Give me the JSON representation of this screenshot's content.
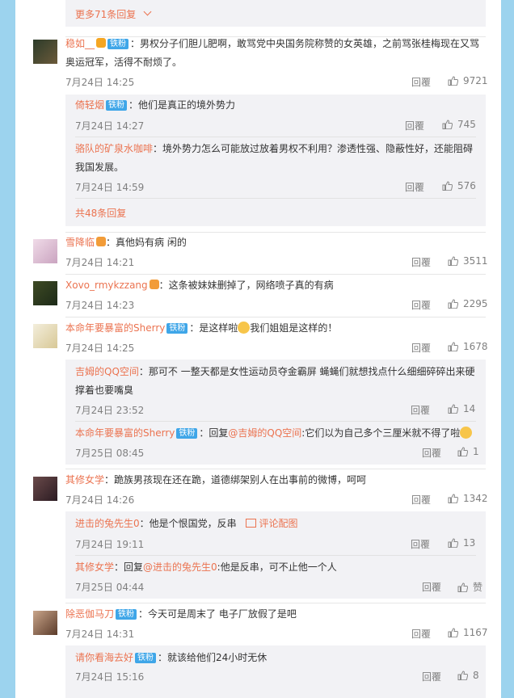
{
  "top_more": {
    "label": "更多71条回复"
  },
  "action_reply": "回覆",
  "comments": [
    {
      "user": "稳如__",
      "badge": "铁粉",
      "text": "：男权分子们胆儿肥啊，敢骂党中央国务院称赞的女英雄，之前骂张桂梅现在又骂奥运冠军，活得不耐烦了。",
      "time": "7月24日 14:25",
      "likes": "9721",
      "replies": [
        {
          "user": "倚轻烟",
          "badge": "铁粉",
          "text": "：他们是真正的境外势力",
          "time": "7月24日 14:27",
          "likes": "745"
        },
        {
          "user": "骆队的矿泉水咖啡",
          "text": "：境外势力怎么可能放过放着男权不利用？渗透性强、隐蔽性好，还能阻碍我国发展。",
          "time": "7月24日 14:59",
          "likes": "576"
        }
      ],
      "more": "共48条回复"
    },
    {
      "user": "雪降临",
      "text": "：真他妈有病 闲的",
      "time": "7月24日 14:21",
      "likes": "3511"
    },
    {
      "user": "Xovo_rmykzzang",
      "text": "：这条被妹妹删掉了，网络喷子真的有病",
      "time": "7月24日 14:23",
      "likes": "2295"
    },
    {
      "user": "本命年要暴富的Sherry",
      "badge": "铁粉",
      "text": "：是这样啦",
      "text2": "我们姐姐是这样的！",
      "time": "7月24日 14:25",
      "likes": "1678",
      "replies": [
        {
          "user": "吉姆的QQ空间",
          "text": "：那可不 一整天都是女性运动员夺金霸屏 蝇蝇们就想找点什么细细碎碎出来硬撑着也要嘴臭",
          "time": "7月24日 23:52",
          "likes": "14"
        },
        {
          "user": "本命年要暴富的Sherry",
          "badge": "铁粉",
          "text": "：回复",
          "mention": "@吉姆的QQ空间",
          "text2": ":它们以为自己多个三厘米就不得了啦",
          "time": "7月25日 08:45",
          "likes": "1"
        }
      ]
    },
    {
      "user": "其修女学",
      "text": "：跪族男孩现在还在跪，道德绑架别人在出事前的微博，呵呵",
      "time": "7月24日 14:26",
      "likes": "1342",
      "replies": [
        {
          "user": "进击的兔先生0",
          "text": "：他是个恨国党，反串",
          "piclabel": "评论配图",
          "time": "7月24日 19:11",
          "likes": "13"
        },
        {
          "user": "其修女学",
          "text": "：回复",
          "mention": "@进击的兔先生0",
          "text2": ":他是反串，可不止他一个人",
          "time": "7月25日 04:44",
          "likes": "赞"
        }
      ]
    },
    {
      "user": "除恶伽马刀",
      "badge": "铁粉",
      "text": "：今天可是周末了 电子厂放假了是吧",
      "time": "7月24日 14:31",
      "likes": "1167",
      "replies": [
        {
          "user": "请你看海去好",
          "badge": "铁粉",
          "text": "：就该给他们24小时无休",
          "time": "7月24日 15:16",
          "likes": "8"
        }
      ]
    }
  ],
  "colors": {
    "accent": "#eb7350",
    "badge": "#3fa6e8",
    "frame": "#9cd3ee",
    "reply_bg": "#f2f2f5"
  }
}
